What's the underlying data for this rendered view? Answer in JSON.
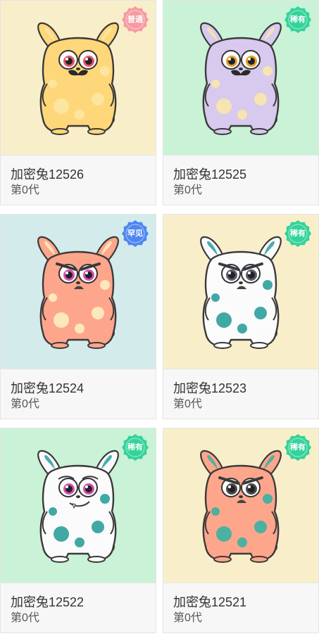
{
  "cards": [
    {
      "name": "加密兔12526",
      "generation": "第0代",
      "rarity": "普通",
      "bg": "#f8efca",
      "badge_color": "#f79aa2",
      "body": "#fed77a",
      "spots": "#fbe9a6",
      "eyes": "#e5536e",
      "mood": "mustache"
    },
    {
      "name": "加密兔12525",
      "generation": "第0代",
      "rarity": "稀有",
      "bg": "#c9f2d6",
      "badge_color": "#34d39a",
      "body": "#d8c9ee",
      "spots": "#fbe9a6",
      "eyes": "#e0a02c",
      "mood": "mustache"
    },
    {
      "name": "加密兔12524",
      "generation": "第0代",
      "rarity": "罕见",
      "bg": "#d4ebec",
      "badge_color": "#4e86f2",
      "body": "#fea68c",
      "spots": "#fdf2c6",
      "eyes": "#d34fb3",
      "mood": "angry"
    },
    {
      "name": "加密兔12523",
      "generation": "第0代",
      "rarity": "稀有",
      "bg": "#f8efca",
      "badge_color": "#34d39a",
      "body": "#fbfbfb",
      "spots": "#1f9a97",
      "eyes": "#5b5b73",
      "mood": "angry"
    },
    {
      "name": "加密兔12522",
      "generation": "第0代",
      "rarity": "稀有",
      "bg": "#c9f2d6",
      "badge_color": "#34d39a",
      "body": "#fbfbfb",
      "spots": "#1f9a97",
      "eyes": "#d34fb3",
      "mood": "fang"
    },
    {
      "name": "加密兔12521",
      "generation": "第0代",
      "rarity": "稀有",
      "bg": "#f8efca",
      "badge_color": "#34d39a",
      "body": "#fea68c",
      "spots": "#2bb3a4",
      "eyes": "#4a4a4a",
      "mood": "angry"
    }
  ]
}
